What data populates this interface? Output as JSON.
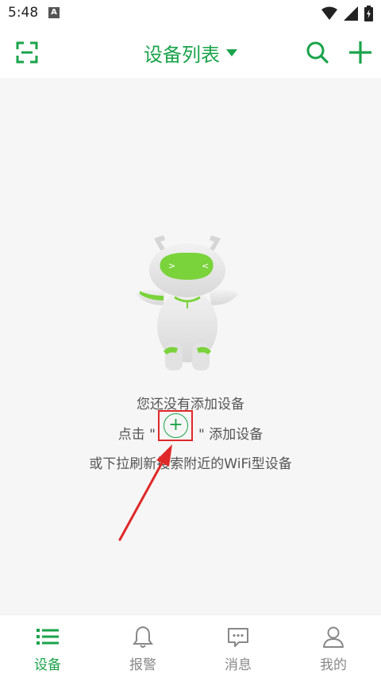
{
  "status_bar": {
    "time": "5:48",
    "notification_letter": "A",
    "icons": [
      "wifi-icon",
      "signal-icon",
      "battery-icon"
    ]
  },
  "header": {
    "title": "设备列表",
    "icons": [
      "scan-icon",
      "dropdown-icon",
      "search-icon",
      "add-icon"
    ]
  },
  "empty_state": {
    "line1": "您还没有添加设备",
    "line2_prefix": "点击 \"",
    "line2_suffix": "\" 添加设备",
    "line3": "或下拉刷新搜索附近的WiFi型设备",
    "plus_symbol": "+"
  },
  "bottom_nav": {
    "items": [
      {
        "label": "设备",
        "icon": "list-icon",
        "active": true
      },
      {
        "label": "报警",
        "icon": "bell-icon",
        "active": false
      },
      {
        "label": "消息",
        "icon": "message-icon",
        "active": false
      },
      {
        "label": "我的",
        "icon": "user-icon",
        "active": false
      }
    ]
  },
  "colors": {
    "accent": "#1aa34a",
    "highlight": "#e02828",
    "background": "#f6f6f6"
  }
}
